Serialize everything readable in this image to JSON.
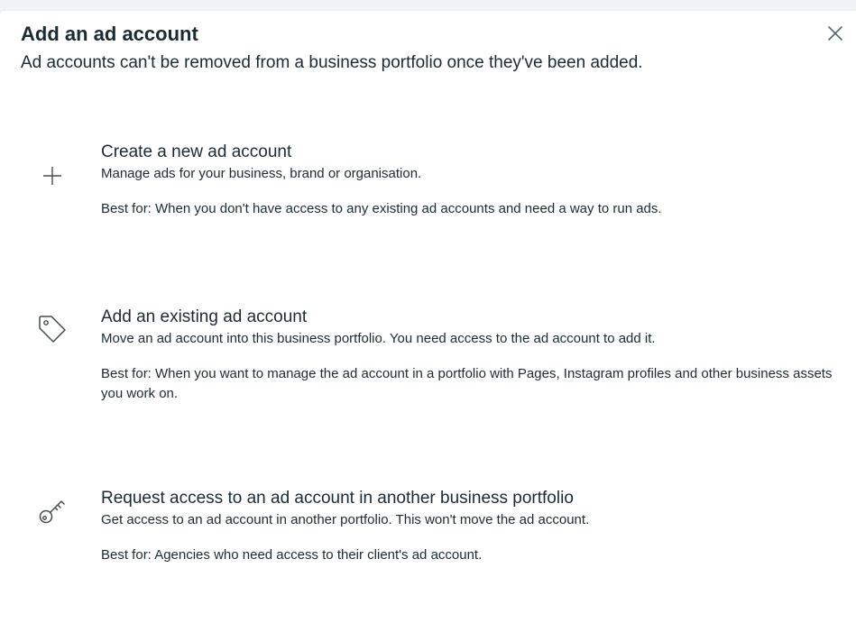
{
  "dialog": {
    "title": "Add an ad account",
    "subtitle": "Ad accounts can't be removed from a business portfolio once they've been added.",
    "close_icon": "close-icon"
  },
  "options": [
    {
      "icon": "plus-icon",
      "title": "Create a new ad account",
      "description": "Manage ads for your business, brand or organisation.",
      "best_for": "Best for: When you don't have access to any existing ad accounts and need a way to run ads."
    },
    {
      "icon": "tag-icon",
      "title": "Add an existing ad account",
      "description": "Move an ad account into this business portfolio. You need access to the ad account to add it.",
      "best_for": "Best for: When you want to manage the ad account in a portfolio with Pages, Instagram profiles and other business assets you work on."
    },
    {
      "icon": "key-icon",
      "title": "Request access to an ad account in another business portfolio",
      "description": "Get access to an ad account in another portfolio. This won't move the ad account.",
      "best_for": "Best for: Agencies who need access to their client's ad account."
    }
  ],
  "colors": {
    "text": "#1c2b33",
    "background": "#ffffff",
    "page_background": "#f0f2f5"
  }
}
